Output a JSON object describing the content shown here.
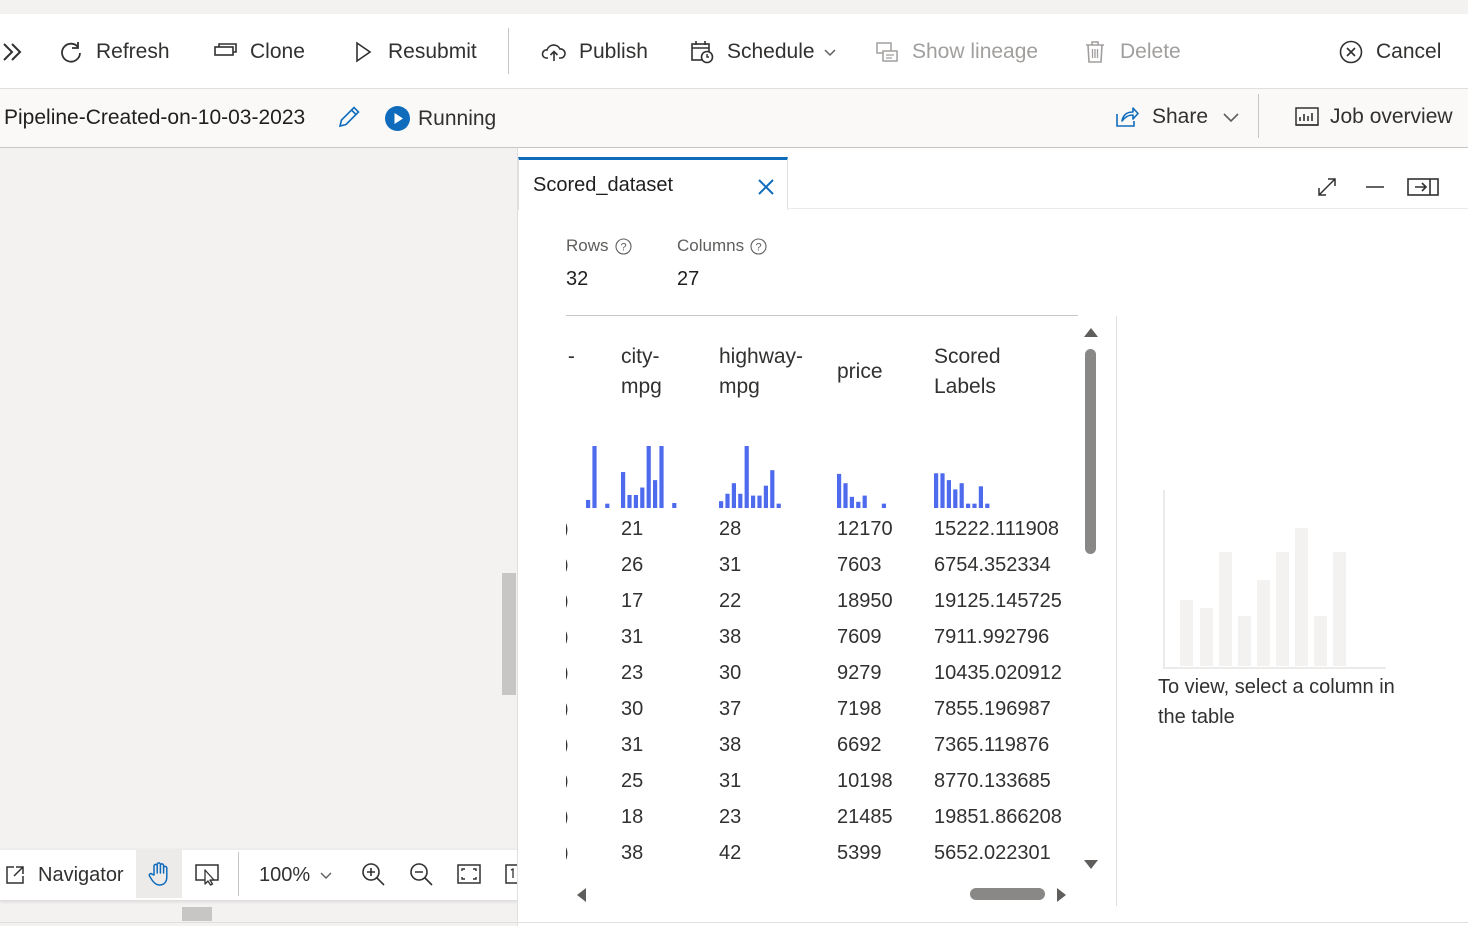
{
  "toolbar": {
    "expand_label": "",
    "refresh": "Refresh",
    "clone": "Clone",
    "resubmit": "Resubmit",
    "publish": "Publish",
    "schedule": "Schedule",
    "show_lineage": "Show lineage",
    "delete": "Delete",
    "cancel": "Cancel"
  },
  "pipeline": {
    "name": "Pipeline-Created-on-10-03-2023",
    "status": "Running",
    "share": "Share",
    "job_overview": "Job overview"
  },
  "navigator": {
    "label": "Navigator",
    "zoom": "100%"
  },
  "dataset": {
    "tab_title": "Scored_dataset",
    "rows_label": "Rows",
    "rows_value": "32",
    "columns_label": "Columns",
    "columns_value": "27",
    "partial_header": ":-",
    "headers": [
      [
        "city-",
        "mpg"
      ],
      [
        "highway-",
        "mpg"
      ],
      [
        "price"
      ],
      [
        "Scored",
        "Labels"
      ]
    ],
    "histograms": [
      [
        0,
        0,
        0,
        0,
        0,
        0.13,
        1.0,
        0,
        0.07
      ],
      [
        0.58,
        0.21,
        0.21,
        0.33,
        1.0,
        0.45,
        1.0,
        0,
        0.08
      ],
      [
        0.11,
        0.23,
        0.4,
        0.23,
        1.0,
        0.2,
        0.2,
        0.36,
        0.61,
        0.07
      ],
      [
        0.55,
        0.4,
        0.18,
        0.1,
        0.2,
        0,
        0,
        0.07
      ],
      [
        0.56,
        0.56,
        0.45,
        0.3,
        0.4,
        0.07,
        0.07,
        0.35,
        0.07
      ]
    ],
    "rows": [
      [
        "21",
        "28",
        "12170",
        "15222.111908"
      ],
      [
        "26",
        "31",
        "7603",
        "6754.352334"
      ],
      [
        "17",
        "22",
        "18950",
        "19125.145725"
      ],
      [
        "31",
        "38",
        "7609",
        "7911.992796"
      ],
      [
        "23",
        "30",
        "9279",
        "10435.020912"
      ],
      [
        "30",
        "37",
        "7198",
        "7855.196987"
      ],
      [
        "31",
        "38",
        "6692",
        "7365.119876"
      ],
      [
        "25",
        "31",
        "10198",
        "8770.133685"
      ],
      [
        "18",
        "23",
        "21485",
        "19851.866208"
      ],
      [
        "38",
        "42",
        "5399",
        "5652.022301"
      ]
    ],
    "empty_hint": "To view, select a column in the table"
  },
  "colors": {
    "accent": "#0f6cbd",
    "histogram": "#4f6bed",
    "running": "#0f6cbd"
  },
  "icons": {
    "expand": "double-chevron-icon",
    "refresh": "refresh-icon",
    "clone": "clone-icon",
    "resubmit": "play-outline-icon",
    "publish": "cloud-upload-icon",
    "schedule": "calendar-clock-icon",
    "show_lineage": "lineage-icon",
    "delete": "trash-icon",
    "cancel": "circle-x-icon",
    "edit": "pencil-icon",
    "status": "play-circle-icon",
    "share": "share-icon",
    "job_overview": "chart-board-icon",
    "maximize": "diagonal-expand-icon",
    "minimize": "minus-icon",
    "dock": "dock-right-icon",
    "help": "help-circle-icon"
  }
}
